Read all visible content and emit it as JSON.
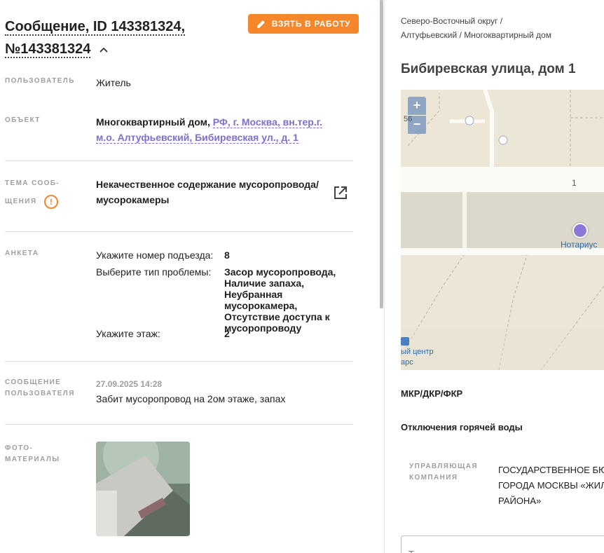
{
  "header": {
    "title": "Сообщение, ID 143381324, №143381324",
    "take_button": "ВЗЯТЬ В РАБОТУ"
  },
  "fields": {
    "user_label": "ПОЛЬЗОВАТЕЛЬ",
    "user_value": "Житель",
    "object_label": "ОБЪЕКТ",
    "object_type": "Многоквартирный дом,",
    "object_link": "РФ, г. Москва, вн.тер.г. м.о. Алтуфьевский, Бибиревская ул., д. 1",
    "topic_label_1": "ТЕМА СООБ-",
    "topic_label_2": "ЩЕНИЯ",
    "topic_value": "Некачественное содержание мусоропровода/ мусорокамеры",
    "survey_label": "АНКЕТА",
    "message_label": "СООБЩЕНИЕ ПОЛЬЗОВАТЕЛЯ",
    "message_date": "27.09.2025 14:28",
    "message_text": "Забит мусоропровод на 2ом этаже, запах",
    "photos_label": "ФОТО-МАТЕРИАЛЫ"
  },
  "survey": [
    {
      "question": "Укажите номер подъезда:",
      "answer": "8"
    },
    {
      "question": "Выберите тип проблемы:",
      "answer": "Засор мусоропровода, Наличие запаха, Неубранная мусорокамера, Отсутствие доступа к мусоропроводу"
    },
    {
      "question": "Укажите этаж:",
      "answer": "2"
    }
  ],
  "right": {
    "breadcrumb_1": "Северо-Восточный округ /",
    "breadcrumb_2": "Алтуфьевский / Многоквартирный дом",
    "address": "Бибиревская улица, дом 1",
    "map": {
      "zoom_in": "+",
      "zoom_out": "−",
      "house_number": "1",
      "poi_label": "Нотариус",
      "corner_text_1": "ый центр",
      "corner_text_2": "арс",
      "left_number": "56"
    },
    "section_1": "МКР/ДКР/ФКР",
    "section_2": "Отключения горячей воды",
    "uk_label": "УПРАВЛЯЮЩАЯ КОМПАНИЯ",
    "uk_value_1": "ГОСУДАРСТВЕННОЕ БЮ",
    "uk_value_2": "ГОРОДА МОСКВЫ «ЖИЛ",
    "uk_value_3": "РАЙОНА»",
    "textarea_placeholder": "Т"
  },
  "colors": {
    "accent_orange": "#f5862a",
    "link_purple": "#7e6fcf"
  }
}
